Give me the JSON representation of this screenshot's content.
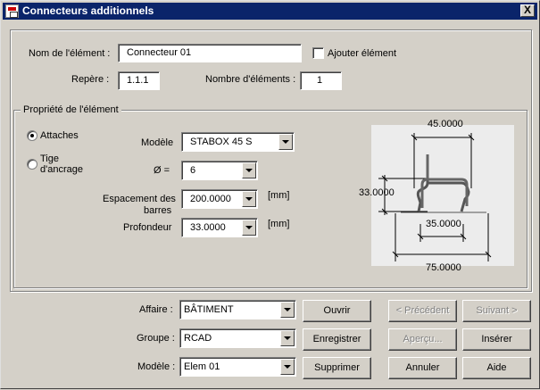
{
  "window": {
    "title": "Connecteurs additionnels",
    "close": "X"
  },
  "element": {
    "name_label": "Nom de l'élément :",
    "name_value": "Connecteur 01",
    "add_element_label": "Ajouter élément",
    "add_element_checked": false,
    "mark_label": "Repère :",
    "mark_value": "1.1.1",
    "count_label": "Nombre d'éléments :",
    "count_value": "1"
  },
  "properties": {
    "group_title": "Propriété de l'élément",
    "radio_attaches": "Attaches",
    "radio_tige_line1": "Tige",
    "radio_tige_line2": "d'ancrage",
    "selected_radio": "Attaches",
    "model_label": "Modèle",
    "model_value": "STABOX 45 S",
    "diameter_label": "Ø  =",
    "diameter_value": "6",
    "spacing_label_line1": "Espacement des",
    "spacing_label_line2": "barres",
    "spacing_value": "200.0000",
    "spacing_unit": "[mm]",
    "depth_label": "Profondeur",
    "depth_value": "33.0000",
    "depth_unit": "[mm]"
  },
  "drawing": {
    "dim_top": "45.0000",
    "dim_left": "33.0000",
    "dim_inner": "35.0000",
    "dim_bottom": "75.0000"
  },
  "footer": {
    "affaire_label": "Affaire :",
    "affaire_value": "BÂTIMENT",
    "groupe_label": "Groupe :",
    "groupe_value": "RCAD",
    "modele_label": "Modèle :",
    "modele_value": "Elem 01"
  },
  "buttons": {
    "open": "Ouvrir",
    "save": "Enregistrer",
    "delete": "Supprimer",
    "previous": "< Précédent",
    "next": "Suivant >",
    "preview": "Aperçu...",
    "insert": "Insérer",
    "cancel": "Annuler",
    "help": "Aide"
  }
}
